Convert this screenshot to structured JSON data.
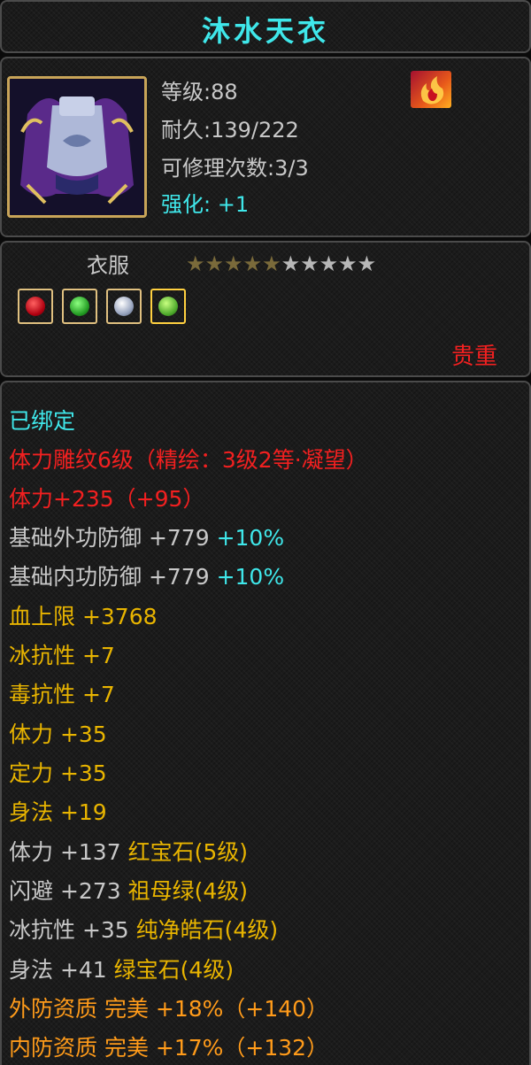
{
  "item": {
    "name": "沐水天衣",
    "level": "等级:88",
    "durability": "耐久:139/222",
    "repair_count": "可修理次数:3/3",
    "enhance_label": "强化:",
    "enhance_value": "+1",
    "type": "衣服",
    "stars_total": 10,
    "stars_filled": 5,
    "rarity": "贵重",
    "icons": {
      "portrait": "armor-portrait-icon",
      "badge": "flame-badge-icon",
      "gems": [
        "red-gem-icon",
        "green-gem-icon",
        "white-gem-icon",
        "green-gem-icon"
      ]
    }
  },
  "attributes": {
    "bound": "已绑定",
    "engrave": "体力雕纹6级（精绘：3级2等·凝望）",
    "stamina_main": "体力+235（+95）",
    "ext_def_label": "基础外功防御 +779",
    "ext_def_pct": "+10%",
    "int_def_label": "基础内功防御 +779",
    "int_def_pct": "+10%",
    "hp": "血上限 +3768",
    "ice_res": "冰抗性 +7",
    "poison_res": "毒抗性 +7",
    "stamina": "体力 +35",
    "focus": "定力 +35",
    "agility": "身法 +19",
    "gem1_stat": "体力 +137",
    "gem1_name": "红宝石(5级)",
    "gem2_stat": "闪避 +273",
    "gem2_name": "祖母绿(4级)",
    "gem3_stat": "冰抗性 +35",
    "gem3_name": "纯净皓石(4级)",
    "gem4_stat": "身法 +41",
    "gem4_name": "绿宝石(4级)",
    "ext_quality": "外防资质  完美 +18%（+140）",
    "int_quality": "内防资质  完美 +17%（+132）"
  },
  "colors": {
    "title": "#3fe7ea",
    "red": "#f22020",
    "gray": "#c8c8c8",
    "yellow": "#e8b400",
    "orange": "#ff9b1a"
  }
}
